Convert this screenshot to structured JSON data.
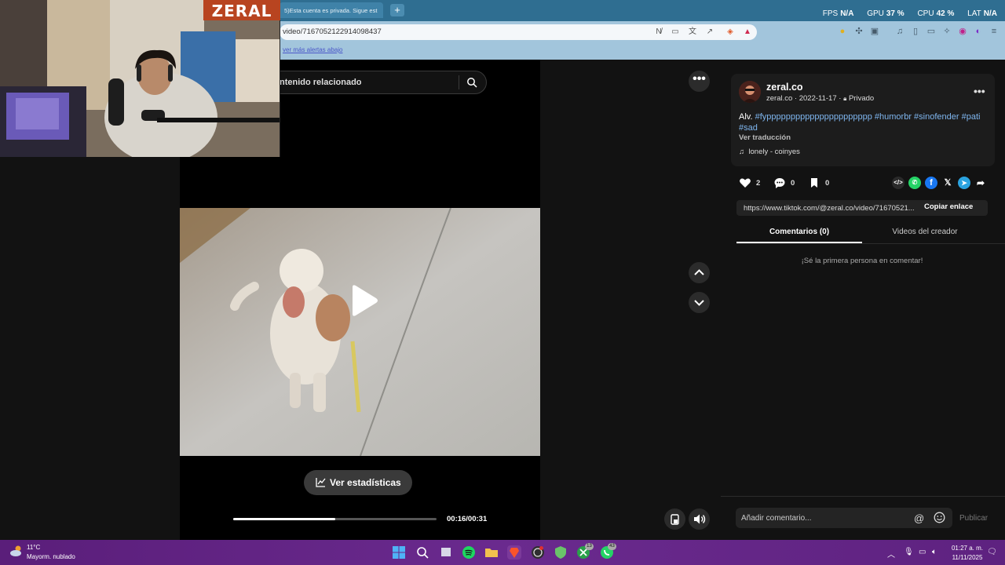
{
  "browser": {
    "tab_title": "5)Esta cuenta es privada. Sigue est",
    "newtab_label": "+",
    "url": "video/7167052122914098437",
    "bookmark_text": "ver más alertas abajo",
    "stats": [
      {
        "label": "FPS",
        "value": "N/A"
      },
      {
        "label": "GPU",
        "value": "37 %"
      },
      {
        "label": "CPU",
        "value": "42 %"
      },
      {
        "label": "LAT",
        "value": "N/A"
      }
    ]
  },
  "webcam": {
    "logo_text": "ZERAL"
  },
  "search": {
    "placeholder": "ntenido relacionado"
  },
  "player": {
    "stats_button": "Ver estadísticas",
    "time": "00:16/00:31",
    "progress": 0.5
  },
  "post": {
    "username": "zeral.co",
    "handle": "zeral.co",
    "date": "2022-11-17",
    "privacy": "Privado",
    "caption_text": "Alv. ",
    "hashtags": [
      "#fypppppppppppppppppppppp",
      "#humorbr",
      "#sinofender",
      "#pati",
      "#sad"
    ],
    "translate": "Ver traducción",
    "music": "lonely - coinyes",
    "likes": "2",
    "comments": "0",
    "saves": "0",
    "link": "https://www.tiktok.com/@zeral.co/video/71670521...",
    "copy_label": "Copiar enlace"
  },
  "tabs": {
    "comments": "Comentarios (0)",
    "creator": "Videos del creador"
  },
  "comments": {
    "empty": "¡Sé la primera persona en comentar!",
    "placeholder": "Añadir comentario...",
    "publish": "Publicar"
  },
  "taskbar": {
    "temperature": "11°C",
    "weather": "Mayorm. nublado",
    "time": "01:27 a. m.",
    "date": "11/11/2025",
    "badge_xbox": "13",
    "badge_whatsapp": "43"
  },
  "colors": {
    "accent_tab": "#2f6e91",
    "hashtag": "#7fb6ef",
    "taskbar": "#5a1e7a"
  }
}
